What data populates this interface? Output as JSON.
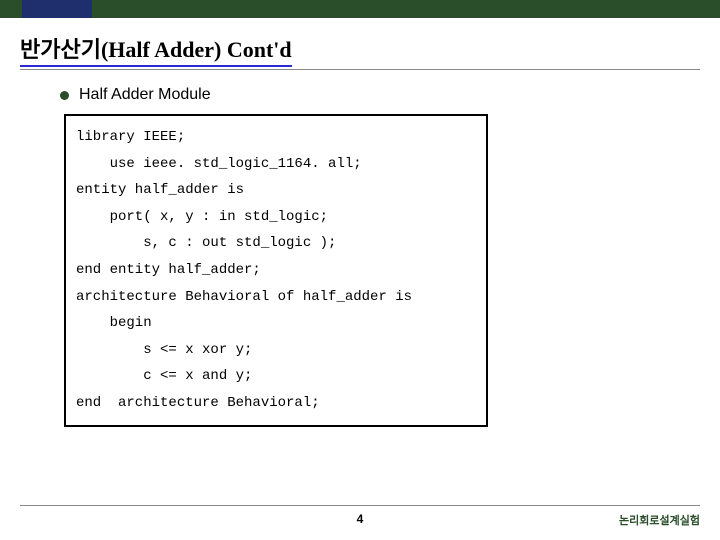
{
  "header": {
    "title": "반가산기(Half Adder) Cont'd"
  },
  "bullet": {
    "label": "Half Adder Module"
  },
  "code": {
    "lines": [
      "library IEEE;",
      "    use ieee. std_logic_1164. all;",
      "",
      "entity half_adder is",
      "    port( x, y : in std_logic;",
      "        s, c : out std_logic );",
      "end entity half_adder;",
      "",
      "architecture Behavioral of half_adder is",
      "    begin",
      "        s <= x xor y;",
      "        c <= x and y;",
      "end  architecture Behavioral;"
    ]
  },
  "footer": {
    "page": "4",
    "label": "논리회로설계실험"
  }
}
